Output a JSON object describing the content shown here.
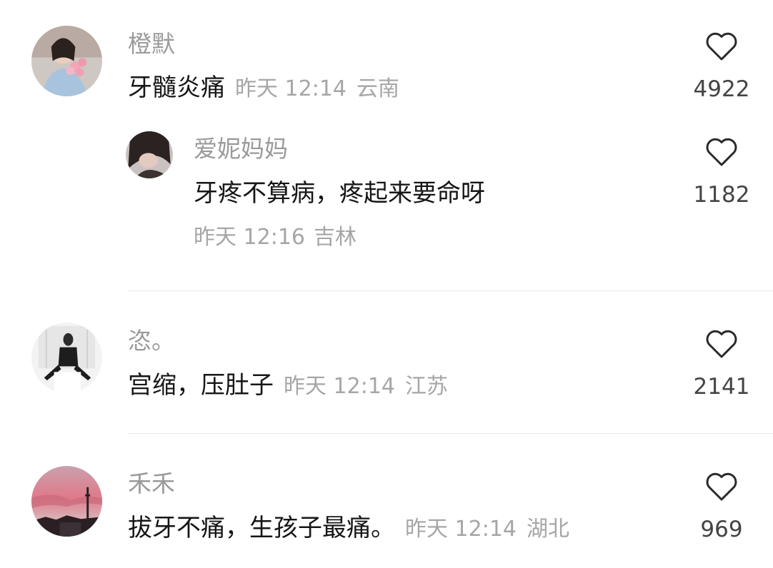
{
  "comments": [
    {
      "username": "橙默",
      "content": "牙髓炎痛",
      "time": "昨天 12:14",
      "location": "云南",
      "likes": "4922",
      "replies": [
        {
          "username": "爱妮妈妈",
          "content": "牙疼不算病，疼起来要命呀",
          "time": "昨天 12:16",
          "location": "吉林",
          "likes": "1182"
        }
      ]
    },
    {
      "username": "恣。",
      "content": "宫缩，压肚子",
      "time": "昨天 12:14",
      "location": "江苏",
      "likes": "2141"
    },
    {
      "username": "禾禾",
      "content": "拔牙不痛，生孩子最痛。",
      "time": "昨天 12:14",
      "location": "湖北",
      "likes": "969"
    }
  ],
  "icons": {
    "like": "heart-outline-icon"
  }
}
